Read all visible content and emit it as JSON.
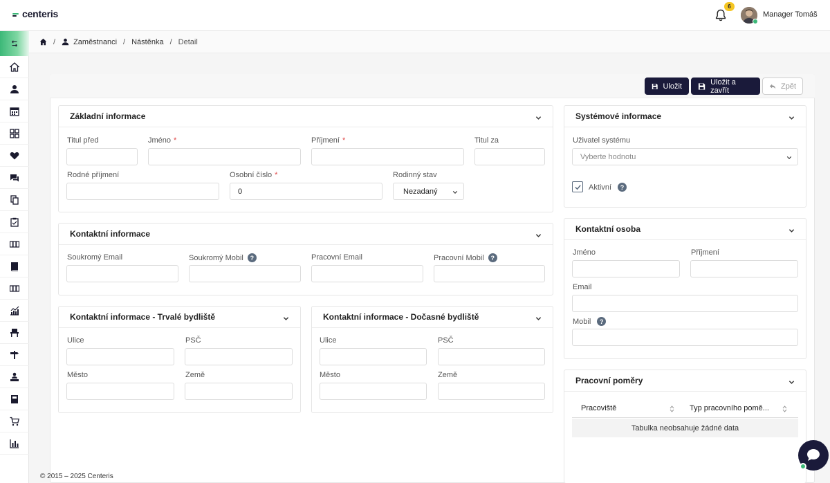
{
  "app": {
    "logo": "centeris",
    "notifications_count": "6",
    "user_name": "Manager Tomáš"
  },
  "breadcrumb": {
    "employees": "Zaměstnanci",
    "dashboard": "Nástěnka",
    "detail": "Detail"
  },
  "toolbar": {
    "save": "Uložit",
    "save_close": "Uložit a zavřít",
    "back": "Zpět"
  },
  "basic": {
    "title": "Základní informace",
    "title_before": "Titul před",
    "first_name": "Jméno",
    "last_name": "Příjmení",
    "title_after": "Titul za",
    "birth_name": "Rodné příjmení",
    "personal_number": "Osobní číslo",
    "personal_number_value": "0",
    "marital_status": "Rodinný stav",
    "marital_status_value": "Nezadaný"
  },
  "contact": {
    "title": "Kontaktní informace",
    "private_email": "Soukromý Email",
    "private_mobile": "Soukromý Mobil",
    "work_email": "Pracovní Email",
    "work_mobile": "Pracovní Mobil"
  },
  "permanent": {
    "title": "Kontaktní informace - Trvalé bydliště",
    "street": "Ulice",
    "zip": "PSČ",
    "city": "Město",
    "country": "Země"
  },
  "temporary": {
    "title": "Kontaktní informace - Dočasné bydliště",
    "street": "Ulice",
    "zip": "PSČ",
    "city": "Město",
    "country": "Země"
  },
  "system": {
    "title": "Systémové informace",
    "system_user": "Uživatel systému",
    "system_user_placeholder": "Vyberte hodnotu",
    "active": "Aktivní"
  },
  "contact_person": {
    "title": "Kontaktní osoba",
    "first_name": "Jméno",
    "last_name": "Příjmení",
    "email": "Email",
    "mobile": "Mobil"
  },
  "employment": {
    "title": "Pracovní poměry",
    "col_workplace": "Pracoviště",
    "col_type": "Typ pracovního pomě...",
    "empty": "Tabulka neobsahuje žádné data"
  },
  "footer": "© 2015 – 2025 Centeris",
  "colors": {
    "brand_dark": "#1a1a3a",
    "brand_green": "#3cb878",
    "required": "#e04848"
  }
}
